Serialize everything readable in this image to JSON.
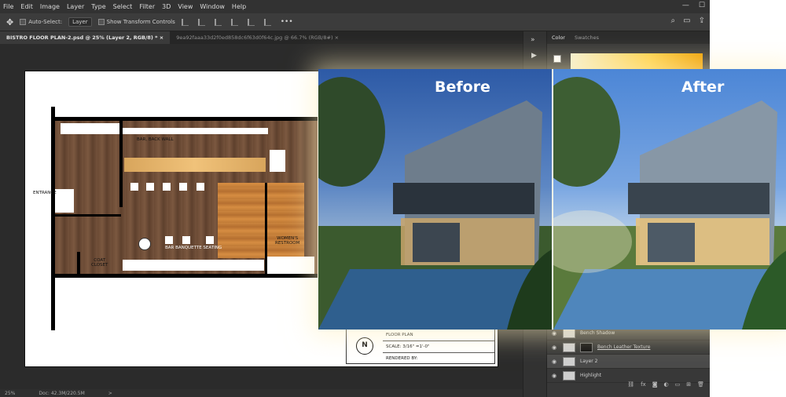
{
  "menu": [
    "File",
    "Edit",
    "Image",
    "Layer",
    "Type",
    "Select",
    "Filter",
    "3D",
    "View",
    "Window",
    "Help"
  ],
  "window_controls": {
    "minimize": "—",
    "maximize": "☐"
  },
  "options_bar": {
    "auto_select_label": "Auto-Select:",
    "auto_select_value": "Layer",
    "transform_label": "Show Transform Controls",
    "more": "•••"
  },
  "tabs": [
    {
      "label": "BISTRO FLOOR PLAN-2.psd @ 25% (Layer 2, RGB/8) *",
      "close": "×"
    },
    {
      "label": "9ea92faaa33d2f0ed858dc6f63d0f64c.jpg @ 66.7% (RGB/8#)",
      "close": "×"
    }
  ],
  "floor_plan": {
    "labels": {
      "bar_back_wall": "BAR, BACK WALL",
      "entrance": "ENTRANCE",
      "coat_closet": "COAT\nCLOSET",
      "bar_banquette": "BAR  BANQUETTE SEATING",
      "womens_restroom": "WOMEN'S\nRESTROOM"
    },
    "title_block": {
      "north": "N",
      "row1": "FLOOR PLAN",
      "row2": "SCALE: 3/16\" =1'-0\"",
      "row3": "RENDERED BY:"
    }
  },
  "photos": {
    "before_label": "Before",
    "after_label": "After"
  },
  "status": {
    "zoom": "25%",
    "doc": "Doc: 42.3M/220.5M",
    "arrow": ">"
  },
  "panel": {
    "tabs": [
      "Color",
      "Swatches"
    ],
    "layers": [
      {
        "name": "Bench Shadow",
        "selected": false,
        "link": false,
        "dark": false
      },
      {
        "name": "Bench Leather Texture",
        "selected": false,
        "link": true,
        "dark": true
      },
      {
        "name": "Layer 2",
        "selected": true,
        "link": false,
        "dark": false
      },
      {
        "name": "Highlight",
        "selected": false,
        "link": false,
        "dark": false
      }
    ],
    "footer_icons": [
      "fx"
    ]
  },
  "colors": {
    "accent_yellow": "#ffd24a",
    "ui_dark": "#2b2b2b",
    "panel": "#383838"
  }
}
